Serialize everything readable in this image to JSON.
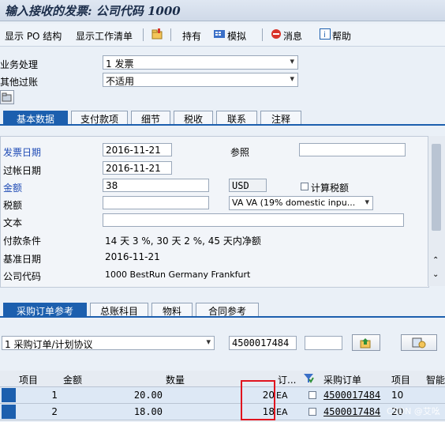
{
  "title": "输入接收的发票: 公司代码 1000",
  "toolbar": {
    "show_po_structure": "显示 PO 结构",
    "show_worklist": "显示工作清单",
    "hold": "持有",
    "simulate": "模拟",
    "messages": "消息",
    "help": "帮助"
  },
  "header": {
    "transaction_label": "业务处理",
    "transaction_value": "1 发票",
    "other_filter_label": "其他过账",
    "other_filter_value": "不适用"
  },
  "tabs_top": [
    "基本数据",
    "支付款项",
    "细节",
    "税收",
    "联系",
    "注释"
  ],
  "basic": {
    "invoice_date_label": "发票日期",
    "invoice_date": "2016-11-21",
    "reference_label": "参照",
    "reference_value": "",
    "posting_date_label": "过帐日期",
    "posting_date": "2016-11-21",
    "amount_label": "金额",
    "amount": "38",
    "currency": "USD",
    "calc_tax_label": "计算税额",
    "tax_label": "税额",
    "tax_value": "",
    "tax_code": "VA VA (19% domestic inpu...",
    "text_label": "文本",
    "text_value": "",
    "payment_terms_label": "付款条件",
    "payment_terms": "14 天 3 %, 30 天 2 %, 45 天内净额",
    "baseline_date_label": "基准日期",
    "baseline_date": "2016-11-21",
    "company_code_label": "公司代码",
    "company_code": "1000 BestRun Germany Frankfurt"
  },
  "tabs_bottom": [
    "采购订单参考",
    "总账科目",
    "物料",
    "合同参考"
  ],
  "po_ref": {
    "ref_type": "1 采购订单/计划协议",
    "po_number": "4500017484",
    "extra": ""
  },
  "table": {
    "headers": [
      "项目",
      "金额",
      "数量",
      "订...",
      "",
      "采购订单",
      "项目",
      "智能"
    ],
    "rows": [
      {
        "item": "1",
        "amount": "20.00",
        "qty": "20",
        "unit": "EA",
        "po": "4500017484",
        "po_item": "10"
      },
      {
        "item": "2",
        "amount": "18.00",
        "qty": "18",
        "unit": "EA",
        "po": "4500017484",
        "po_item": "20"
      }
    ]
  },
  "watermark": "CSDN @艾吆",
  "colors": {
    "accent": "#1c5fae",
    "highlight_box": "#e0141e",
    "link": "#1f4bb5"
  }
}
